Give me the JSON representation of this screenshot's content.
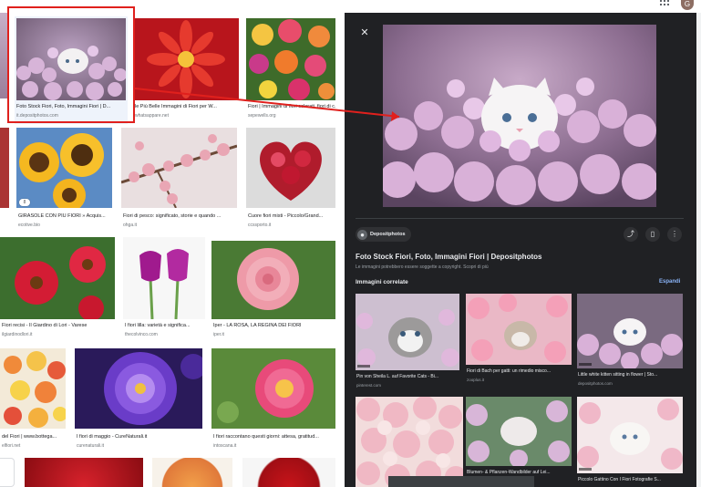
{
  "user": {
    "initial": "G"
  },
  "grid": {
    "tiles": [
      {
        "name": "tile-kitten-flowers",
        "caption": "Foto Stock Fiori, Foto, Immagini Fiori | D...",
        "source": "it.depositphotos.com",
        "selected": true
      },
      {
        "name": "tile-red-dahlia",
        "caption": "le Più Belle Immagini di Fiori per W...",
        "source": "whatsappare.net"
      },
      {
        "name": "tile-bouquet",
        "caption": "Fiori | Immagini di fiori colorati, fiori di c...",
        "source": "sepewells.org"
      },
      {
        "name": "tile-sunflowers",
        "caption": "GIRASOLE CON PIÙ FIORI » Acquis...",
        "source": "ecotive.bio",
        "badge": "8"
      },
      {
        "name": "tile-peach-blossom",
        "caption": "Fiori di pesco: significato, storie e quando ...",
        "source": "ohga.it"
      },
      {
        "name": "tile-heart-flowers",
        "caption": "Cuore fiori misti - Piccolo/Grand...",
        "source": "ccssporto.it"
      },
      {
        "name": "tile-gerbera",
        "caption": "Fiori recisi - Il Giardino di Lori - Varese",
        "source": "ilgiardinodlori.it"
      },
      {
        "name": "tile-tulips",
        "caption": "I fiori lilla: varietà e significa...",
        "source": "thecolvinco.com"
      },
      {
        "name": "tile-rose",
        "caption": "Iper - LA ROSA, LA REGINA DEI FIORI",
        "source": "iper.it"
      },
      {
        "name": "tile-mixed-bouquet",
        "caption": "del Fiori | www.bottega...",
        "source": "elfiori.net"
      },
      {
        "name": "tile-purple-aster",
        "caption": "I fiori di maggio - CureNaturali.it",
        "source": "curenaturali.it"
      },
      {
        "name": "tile-pink-dahlia",
        "caption": "I fiori raccontano questi giorni: attesa, gratitud...",
        "source": "intoscana.it"
      },
      {
        "name": "tile-bottom-1"
      },
      {
        "name": "tile-bottom-2"
      },
      {
        "name": "tile-bottom-3"
      },
      {
        "name": "tile-bottom-4"
      }
    ]
  },
  "panel": {
    "source_name": "Depositphotos",
    "title": "Foto Stock Fiori, Foto, Immagini Fiori | Depositphotos",
    "copyright_note": "Le immagini potrebbero essere soggette a copyright. Scopri di più",
    "related_heading": "Immagini correlate",
    "expand_label": "Espandi",
    "icons": {
      "close": "close-icon",
      "share": "share-icon",
      "save": "bookmark-icon",
      "more": "more-vert-icon"
    },
    "related": [
      {
        "caption": "Pin von Sheila L. auf Favorite Cats - Bi...",
        "source": "pinterest.com"
      },
      {
        "caption": "Fiori di Bach per gatti: un rimedio misco...",
        "source": "zooplus.it"
      },
      {
        "caption": "Little white kitten sitting in flower | Sto...",
        "source": "depositphotos.com"
      },
      {
        "caption": "",
        "source": ""
      },
      {
        "caption": "Blumen- & Pflanzen-Wandbilder auf Lei...",
        "source": "leinwandbilder.com"
      },
      {
        "caption": "Piccolo Gattino Con I Fiori Fotografie S...",
        "source": ""
      }
    ]
  },
  "colors": {
    "panel_bg": "#202124",
    "selection_frame": "#e0201d",
    "link_blue": "#8ab4f8"
  }
}
